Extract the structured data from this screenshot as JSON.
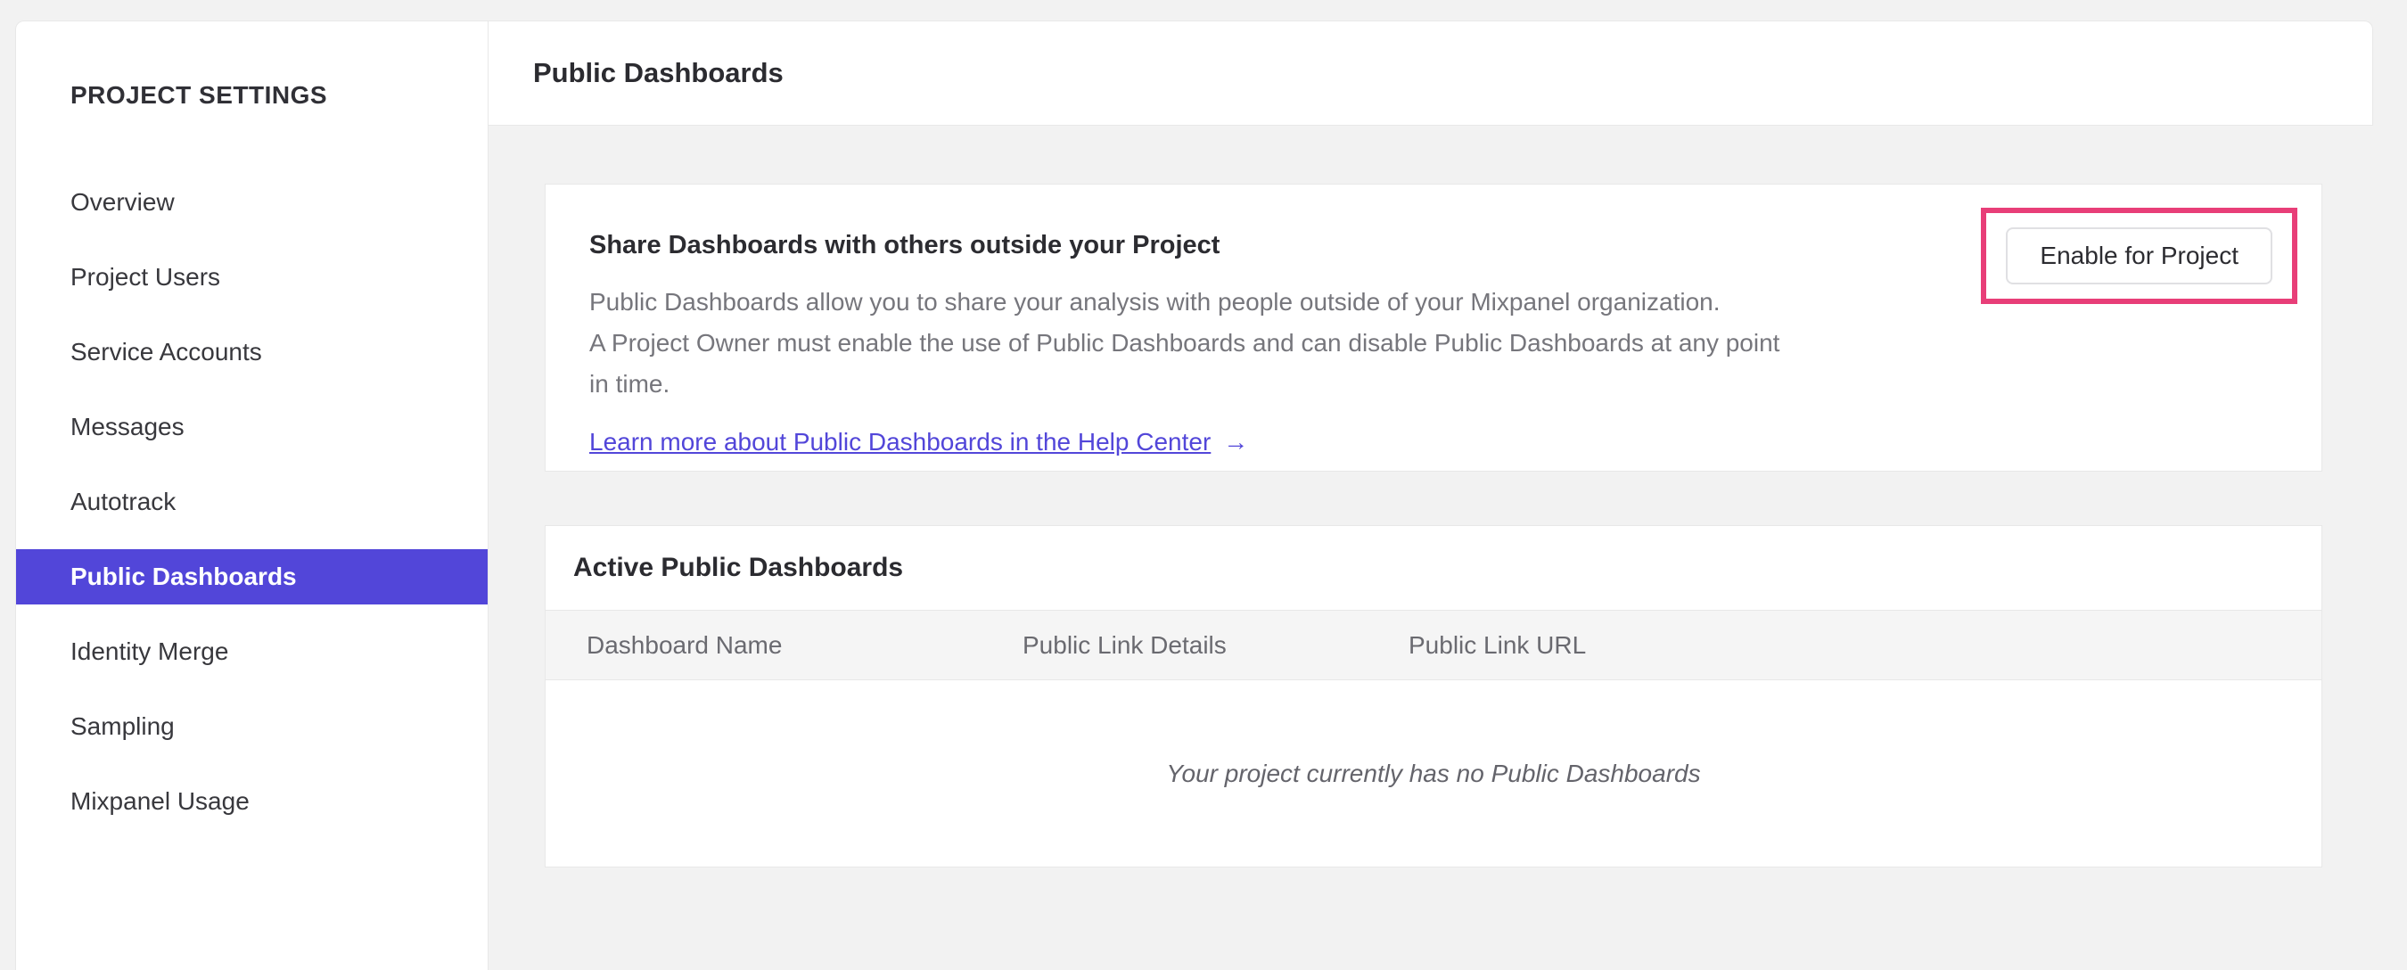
{
  "sidebar": {
    "title": "PROJECT SETTINGS",
    "selected_index": 5,
    "items": [
      {
        "label": "Overview"
      },
      {
        "label": "Project Users"
      },
      {
        "label": "Service Accounts"
      },
      {
        "label": "Messages"
      },
      {
        "label": "Autotrack"
      },
      {
        "label": "Public Dashboards"
      },
      {
        "label": "Identity Merge"
      },
      {
        "label": "Sampling"
      },
      {
        "label": "Mixpanel Usage"
      }
    ]
  },
  "header": {
    "title": "Public Dashboards"
  },
  "share_card": {
    "heading": "Share Dashboards with others outside your Project",
    "body_lines": [
      "Public Dashboards allow you to share your analysis with people outside of your Mixpanel organization.",
      "A Project Owner must enable the use of Public Dashboards and can disable Public Dashboards at any point",
      "in time."
    ],
    "link_label": "Learn more about Public Dashboards in the Help Center",
    "link_arrow": "→",
    "button_label": "Enable for Project"
  },
  "active_card": {
    "heading": "Active Public Dashboards",
    "columns": [
      "Dashboard Name",
      "Public Link Details",
      "Public Link URL"
    ],
    "empty_message": "Your project currently has no Public Dashboards"
  },
  "colors": {
    "selected_nav_bg": "#5246d9",
    "link": "#5246d9",
    "annotation_highlight": "#e83e78"
  }
}
